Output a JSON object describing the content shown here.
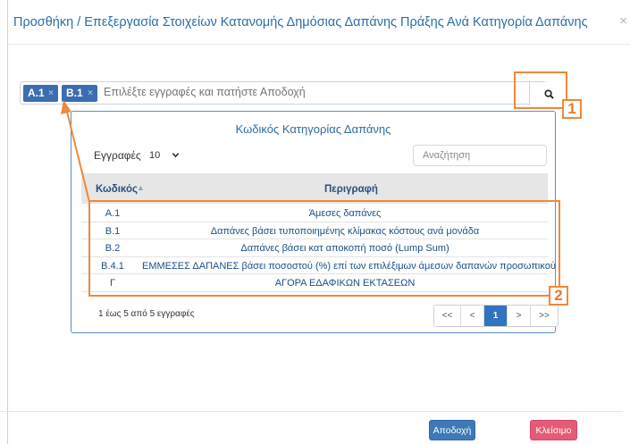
{
  "modal": {
    "title": "Προσθήκη / Επεξεργασία Στοιχείων Κατανομής Δημόσιας Δαπάνης Πράξης Ανά Κατηγορία Δαπάνης",
    "close_glyph": "×"
  },
  "multiselect": {
    "tags": [
      {
        "label": "A.1",
        "remove": "×"
      },
      {
        "label": "B.1",
        "remove": "×"
      }
    ],
    "placeholder": "Επιλέξτε εγγραφές και πατήστε Αποδοχή"
  },
  "panel": {
    "title": "Κωδικός Κατηγορίας Δαπάνης",
    "length_label": "Εγγραφές",
    "length_value": "10",
    "search_placeholder": "Αναζήτηση",
    "columns": {
      "code": "Κωδικός",
      "description": "Περιγραφή"
    },
    "rows": [
      {
        "code": "A.1",
        "description": "Άμεσες δαπάνες"
      },
      {
        "code": "B.1",
        "description": "Δαπάνες βάσει τυποποιημένης κλίμακας κόστους ανά μονάδα"
      },
      {
        "code": "B.2",
        "description": "Δαπάνες βάσει κατ αποκοπή ποσό (Lump Sum)"
      },
      {
        "code": "B.4.1",
        "description": "ΕΜΜΕΣΕΣ ΔΑΠΑΝΕΣ βάσει ποσοστού (%) επί των επιλέξιμων άμεσων δαπανών προσωπικού"
      },
      {
        "code": "Γ",
        "description": "ΑΓΟΡΑ ΕΔΑΦΙΚΩΝ ΕΚΤΑΣΕΩΝ"
      }
    ],
    "info": "1 έως 5 από 5 εγγραφές",
    "pagination": [
      "<<",
      "<",
      "1",
      ">",
      ">>"
    ]
  },
  "footer": {
    "accept": "Αποδοχή",
    "close": "Κλείσιμο"
  },
  "callouts": {
    "one": "1",
    "two": "2"
  },
  "colors": {
    "accent": "#3d78b7",
    "danger": "#e35b75",
    "callout": "#f0883a",
    "title": "#2e6da4"
  }
}
